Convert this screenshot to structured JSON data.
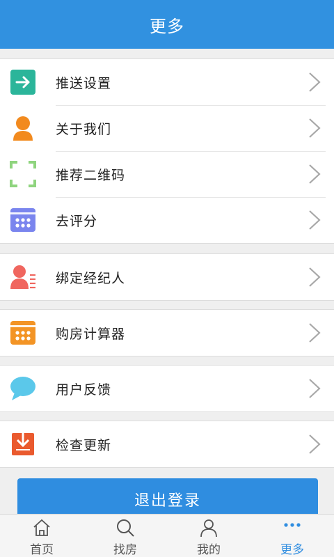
{
  "header": {
    "title": "更多"
  },
  "menu": {
    "group1": [
      {
        "label": "推送设置",
        "icon": "arrow-right-icon",
        "color": "#2bb59a"
      },
      {
        "label": "关于我们",
        "icon": "person-icon",
        "color": "#f28a1e"
      },
      {
        "label": "推荐二维码",
        "icon": "qr-scan-frame-icon",
        "color": "#8fd47e"
      },
      {
        "label": "去评分",
        "icon": "calendar-dots-icon",
        "color": "#7a85ee"
      }
    ],
    "group2": [
      {
        "label": "绑定经纪人",
        "icon": "agent-person-icon",
        "color": "#f0665f"
      }
    ],
    "group3": [
      {
        "label": "购房计算器",
        "icon": "calculator-icon",
        "color": "#f39425"
      }
    ],
    "group4": [
      {
        "label": "用户反馈",
        "icon": "chat-bubble-icon",
        "color": "#5bc8ea"
      }
    ],
    "group5": [
      {
        "label": "检查更新",
        "icon": "download-icon",
        "color": "#ea5a2e"
      }
    ]
  },
  "logout": {
    "label": "退出登录"
  },
  "tabbar": {
    "items": [
      {
        "label": "首页",
        "icon": "home-icon"
      },
      {
        "label": "找房",
        "icon": "search-icon"
      },
      {
        "label": "我的",
        "icon": "user-icon"
      },
      {
        "label": "更多",
        "icon": "more-dots-icon",
        "active": true
      }
    ],
    "active_color": "#2f8de0"
  }
}
